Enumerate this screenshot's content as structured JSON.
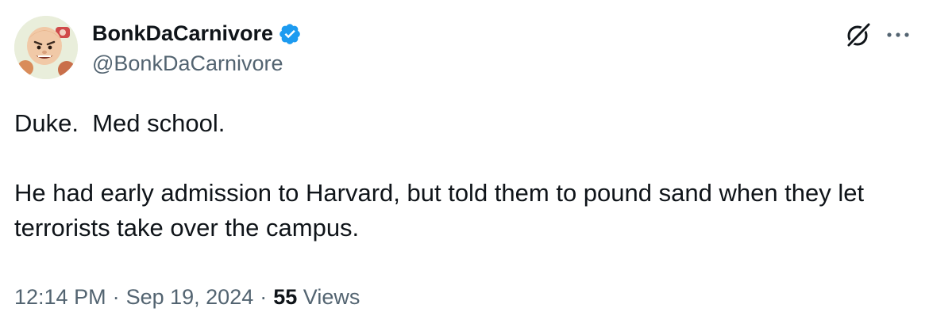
{
  "author": {
    "display_name": "BonkDaCarnivore",
    "handle": "@BonkDaCarnivore",
    "verified": true,
    "verified_color": "#1d9bf0"
  },
  "tweet": {
    "paragraph_1": "Duke.  Med school.",
    "paragraph_2": "He had early admission to Harvard, but told them to pound sand when they let terrorists take over the campus."
  },
  "meta": {
    "time": "12:14 PM",
    "separator": "·",
    "date": "Sep 19, 2024",
    "views_count": "55",
    "views_label": "Views"
  },
  "icons": {
    "grok": "grok-icon",
    "more": "more-icon",
    "verified": "verified-badge-icon"
  },
  "colors": {
    "text_primary": "#0f1419",
    "text_secondary": "#536471",
    "accent": "#1d9bf0"
  }
}
